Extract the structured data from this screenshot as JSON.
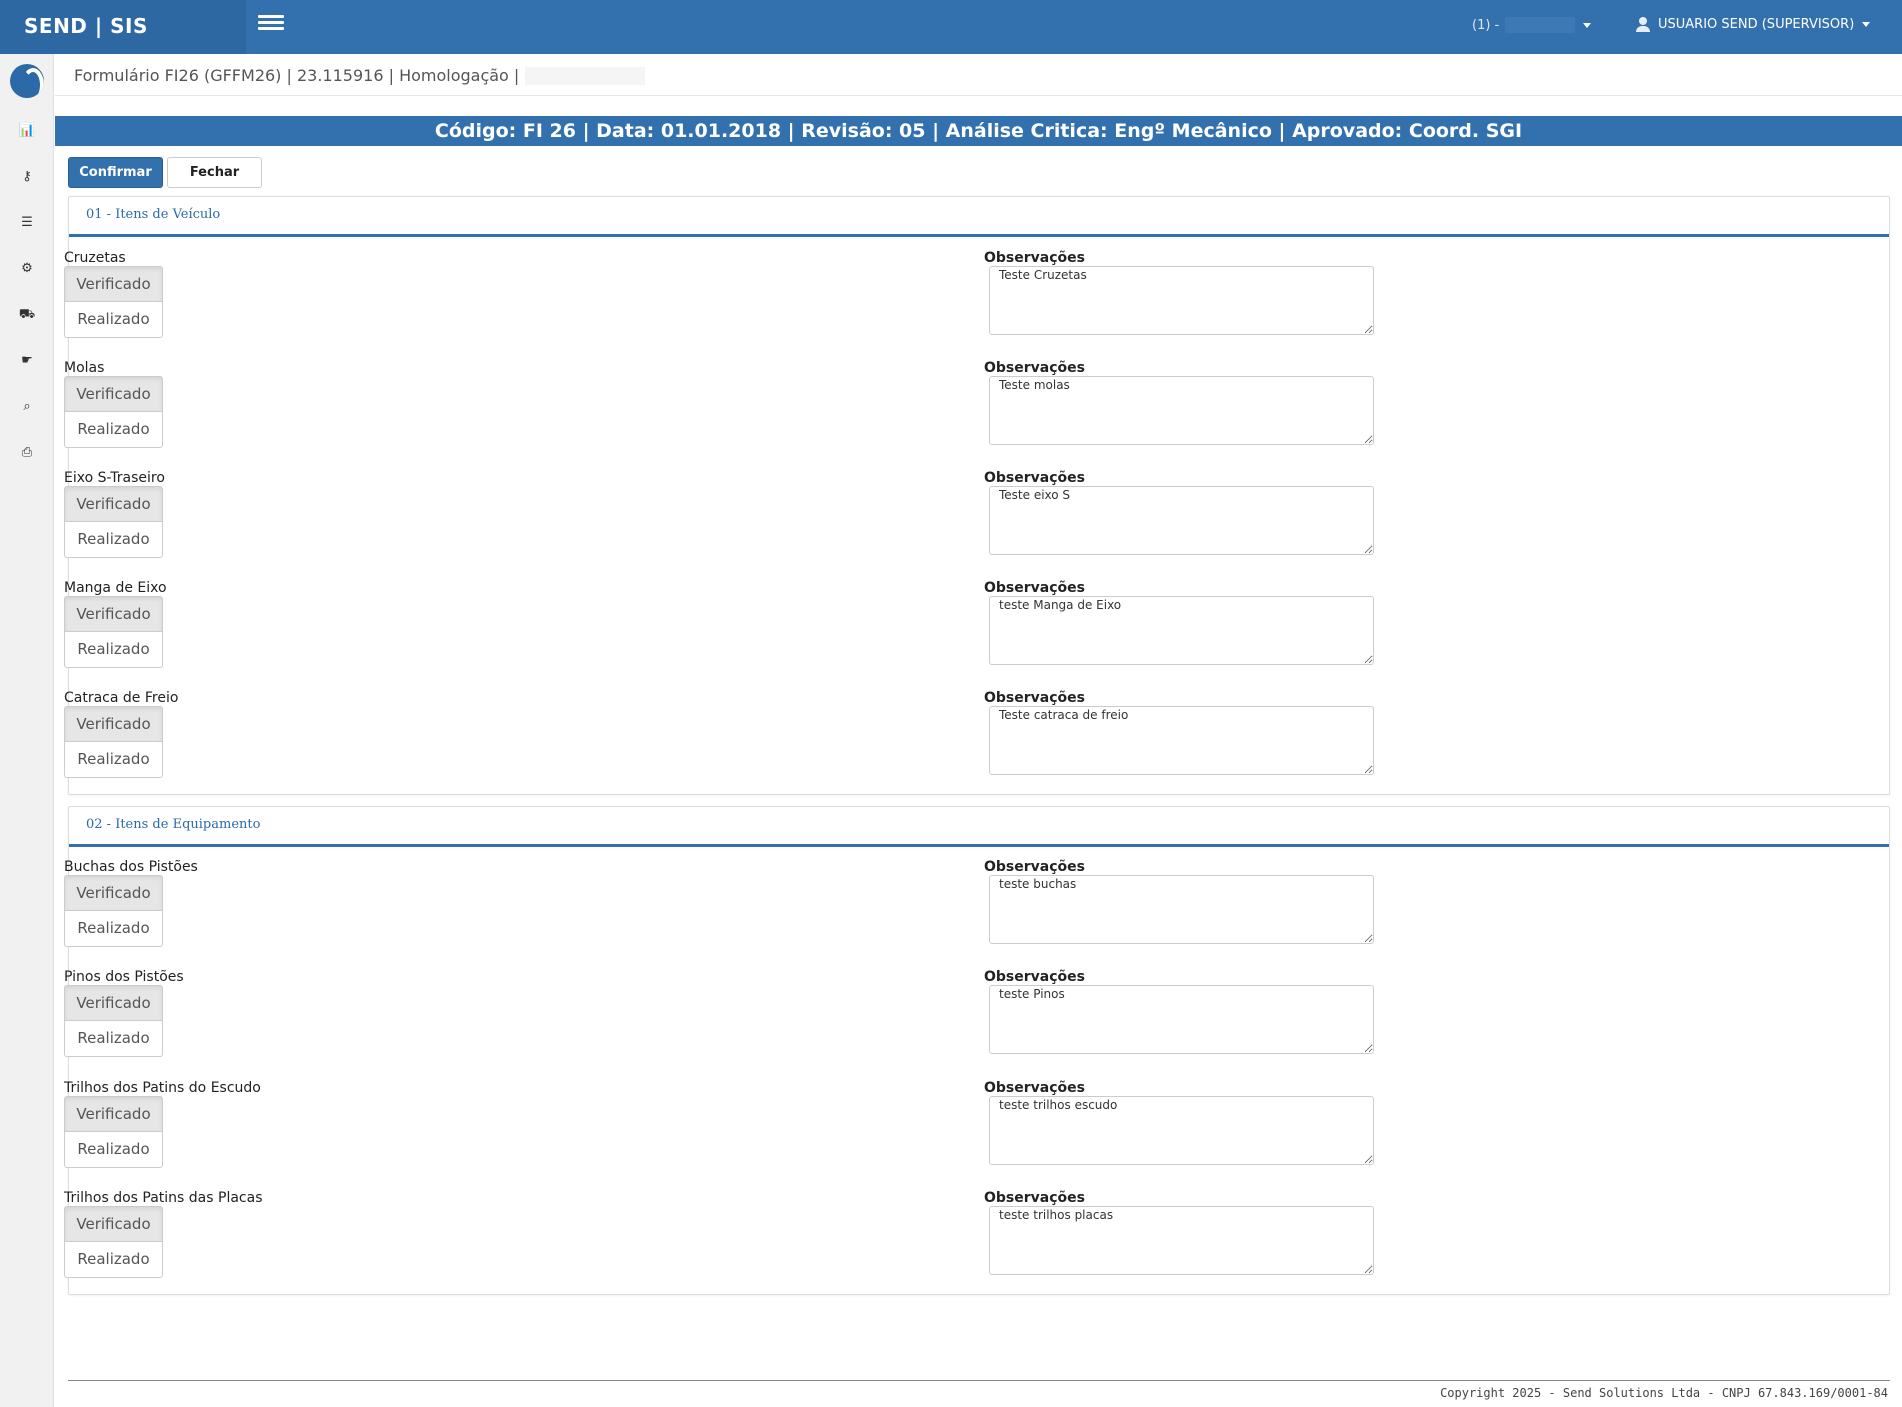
{
  "app": {
    "brand": "SEND | SIS",
    "company_prefix": "(1) -",
    "user": "USUARIO SEND (SUPERVISOR)"
  },
  "sidebar": {
    "items": [
      {
        "icon": "bar-chart-icon",
        "glyph": "📊"
      },
      {
        "icon": "key-icon",
        "glyph": "⚷"
      },
      {
        "icon": "tasks-icon",
        "glyph": "☰"
      },
      {
        "icon": "gears-icon",
        "glyph": "⚙"
      },
      {
        "icon": "truck-icon",
        "glyph": "⛟"
      },
      {
        "icon": "hand-icon",
        "glyph": "☛"
      },
      {
        "icon": "search-icon",
        "glyph": "⌕"
      },
      {
        "icon": "print-icon",
        "glyph": "⎙"
      }
    ]
  },
  "breadcrumb": "Formulário FI26 (GFFM26) | 23.115916 | Homologação |",
  "header": "Código: FI 26 | Data: 01.01.2018 | Revisão: 05 | Análise Critica: Engº Mecânico | Aprovado: Coord. SGI",
  "toolbar": {
    "confirm_label": "Confirmar",
    "close_label": "Fechar"
  },
  "labels": {
    "observations": "Observações",
    "verified": "Verificado",
    "done": "Realizado"
  },
  "sections": [
    {
      "title": "01 - Itens de Veículo",
      "items": [
        {
          "label": "Cruzetas",
          "obs": "Teste Cruzetas"
        },
        {
          "label": "Molas",
          "obs": "Teste molas"
        },
        {
          "label": "Eixo S-Traseiro",
          "obs": "Teste eixo S"
        },
        {
          "label": "Manga de Eixo",
          "obs": "teste Manga de Eixo"
        },
        {
          "label": "Catraca de Freio",
          "obs": "Teste catraca de freio"
        }
      ]
    },
    {
      "title": "02 - Itens de Equipamento",
      "items": [
        {
          "label": "Buchas dos Pistões",
          "obs": "teste buchas"
        },
        {
          "label": "Pinos dos Pistões",
          "obs": "teste Pinos"
        },
        {
          "label": "Trilhos dos Patins do Escudo",
          "obs": "teste trilhos escudo"
        },
        {
          "label": "Trilhos dos Patins das Placas",
          "obs": "teste trilhos placas"
        }
      ]
    }
  ],
  "footer": "Copyright 2025 - Send Solutions Ltda - CNPJ 67.843.169/0001-84"
}
